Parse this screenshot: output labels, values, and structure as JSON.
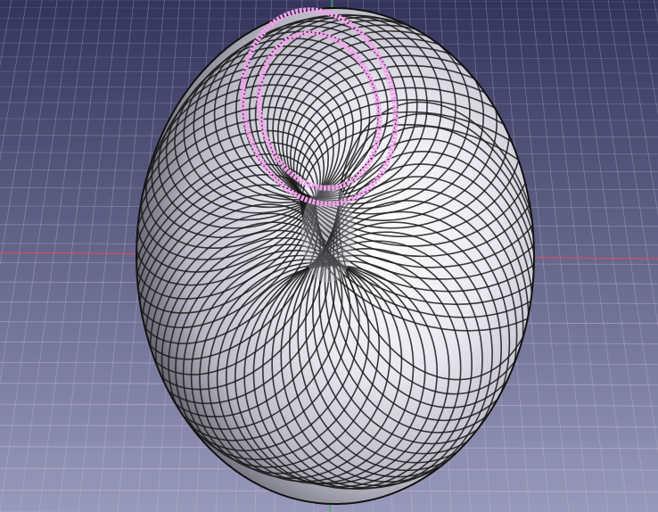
{
  "viewport": {
    "background_top_color": "#33335c",
    "background_bottom_color": "#9999bc",
    "grid_color": "#c9c9de",
    "axis_x_color": "#e05050",
    "axis_y_color": "#2fbf2f"
  },
  "model": {
    "shape": "torus",
    "surface_color": "#e6e6ee",
    "edge_color": "#1a1a1a",
    "selection_color": "#f4a0ec",
    "selected_edge_count": 2
  }
}
